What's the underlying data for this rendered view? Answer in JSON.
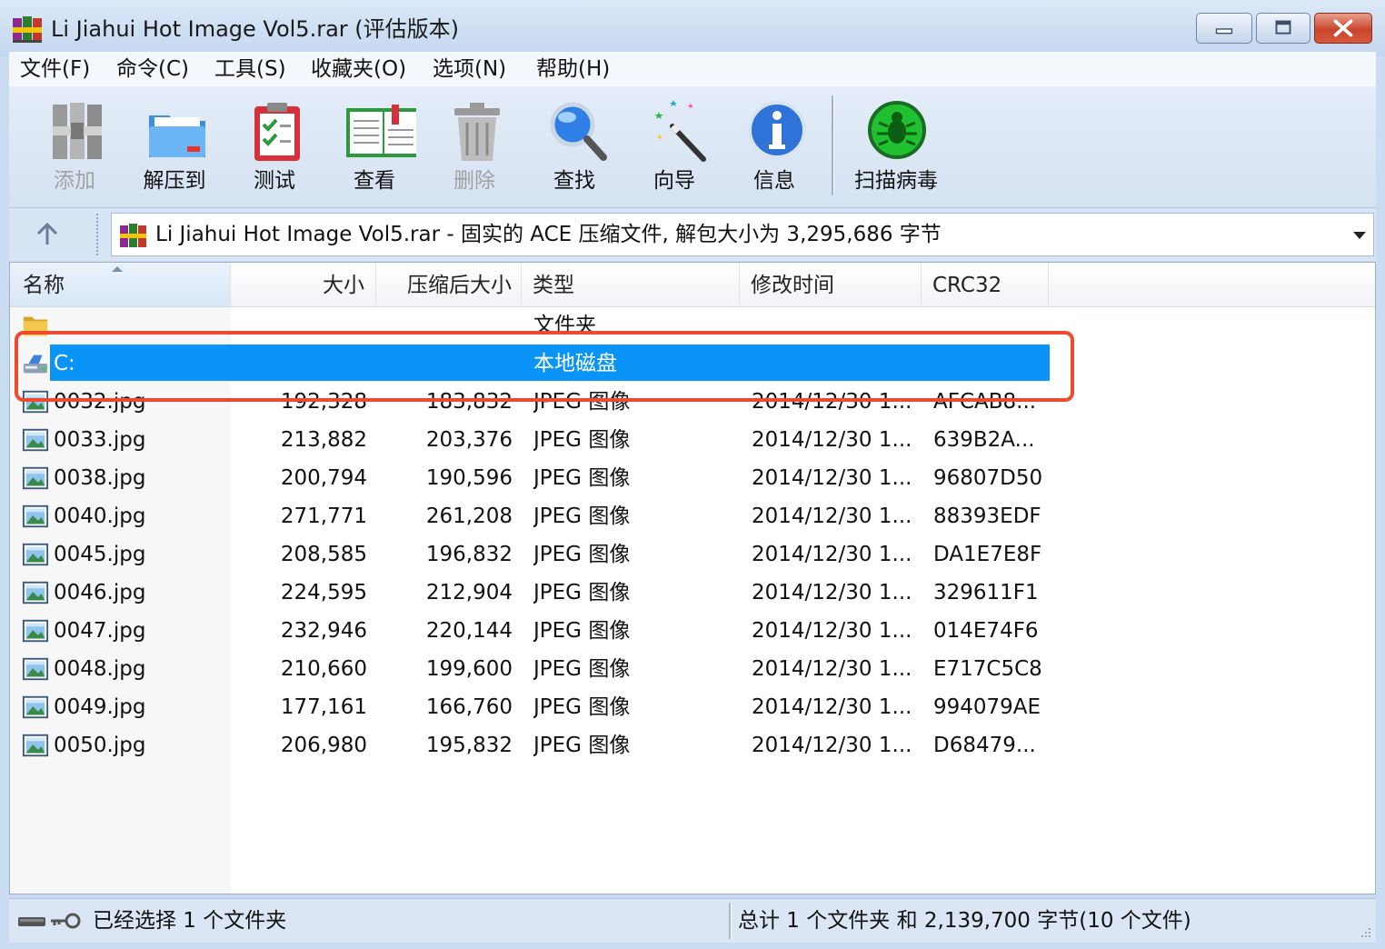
{
  "window": {
    "title": "Li Jiahui Hot Image Vol5.rar (评估版本)",
    "app_icon": "winrar-books-icon",
    "buttons": [
      "minimize",
      "maximize",
      "close"
    ]
  },
  "menu": [
    {
      "label": "文件(F)"
    },
    {
      "label": "命令(C)"
    },
    {
      "label": "工具(S)"
    },
    {
      "label": "收藏夹(O)"
    },
    {
      "label": "选项(N)"
    },
    {
      "label": "帮助(H)"
    }
  ],
  "toolbar": [
    {
      "label": "添加",
      "icon": "add-archive-icon",
      "enabled": false
    },
    {
      "label": "解压到",
      "icon": "extract-folder-icon",
      "enabled": true
    },
    {
      "label": "测试",
      "icon": "test-clipboard-icon",
      "enabled": true
    },
    {
      "label": "查看",
      "icon": "view-book-icon",
      "enabled": true
    },
    {
      "label": "删除",
      "icon": "delete-trash-icon",
      "enabled": false
    },
    {
      "label": "查找",
      "icon": "find-magnifier-icon",
      "enabled": true
    },
    {
      "label": "向导",
      "icon": "wizard-wand-icon",
      "enabled": true
    },
    {
      "label": "信息",
      "icon": "info-icon",
      "enabled": true
    },
    {
      "label": "扫描病毒",
      "icon": "virus-scan-icon",
      "enabled": true
    }
  ],
  "address": {
    "text": "Li Jiahui Hot Image Vol5.rar - 固实的 ACE 压缩文件, 解包大小为 3,295,686 字节"
  },
  "columns": {
    "name": "名称",
    "size": "大小",
    "packed": "压缩后大小",
    "type": "类型",
    "mtime": "修改时间",
    "crc": "CRC32"
  },
  "rows": [
    {
      "icon": "folder-icon",
      "name": "",
      "size": "",
      "packed": "",
      "type": "文件夹",
      "mtime": "",
      "crc": "",
      "selected": false
    },
    {
      "icon": "local-disk-icon",
      "name": "C:",
      "size": "",
      "packed": "",
      "type": "本地磁盘",
      "mtime": "",
      "crc": "",
      "selected": true
    },
    {
      "icon": "image-file-icon",
      "name": "0032.jpg",
      "size": "192,328",
      "packed": "183,832",
      "type": "JPEG 图像",
      "mtime": "2014/12/30 1...",
      "crc": "AFCAB8...",
      "selected": false
    },
    {
      "icon": "image-file-icon",
      "name": "0033.jpg",
      "size": "213,882",
      "packed": "203,376",
      "type": "JPEG 图像",
      "mtime": "2014/12/30 1...",
      "crc": "639B2A...",
      "selected": false
    },
    {
      "icon": "image-file-icon",
      "name": "0038.jpg",
      "size": "200,794",
      "packed": "190,596",
      "type": "JPEG 图像",
      "mtime": "2014/12/30 1...",
      "crc": "96807D50",
      "selected": false
    },
    {
      "icon": "image-file-icon",
      "name": "0040.jpg",
      "size": "271,771",
      "packed": "261,208",
      "type": "JPEG 图像",
      "mtime": "2014/12/30 1...",
      "crc": "88393EDF",
      "selected": false
    },
    {
      "icon": "image-file-icon",
      "name": "0045.jpg",
      "size": "208,585",
      "packed": "196,832",
      "type": "JPEG 图像",
      "mtime": "2014/12/30 1...",
      "crc": "DA1E7E8F",
      "selected": false
    },
    {
      "icon": "image-file-icon",
      "name": "0046.jpg",
      "size": "224,595",
      "packed": "212,904",
      "type": "JPEG 图像",
      "mtime": "2014/12/30 1...",
      "crc": "329611F1",
      "selected": false
    },
    {
      "icon": "image-file-icon",
      "name": "0047.jpg",
      "size": "232,946",
      "packed": "220,144",
      "type": "JPEG 图像",
      "mtime": "2014/12/30 1...",
      "crc": "014E74F6",
      "selected": false
    },
    {
      "icon": "image-file-icon",
      "name": "0048.jpg",
      "size": "210,660",
      "packed": "199,600",
      "type": "JPEG 图像",
      "mtime": "2014/12/30 1...",
      "crc": "E717C5C8",
      "selected": false
    },
    {
      "icon": "image-file-icon",
      "name": "0049.jpg",
      "size": "177,161",
      "packed": "166,760",
      "type": "JPEG 图像",
      "mtime": "2014/12/30 1...",
      "crc": "994079AE",
      "selected": false
    },
    {
      "icon": "image-file-icon",
      "name": "0050.jpg",
      "size": "206,980",
      "packed": "195,832",
      "type": "JPEG 图像",
      "mtime": "2014/12/30 1...",
      "crc": "D68479...",
      "selected": false
    }
  ],
  "status": {
    "left": "已经选择 1 个文件夹",
    "right": "总计 1 个文件夹 和 2,139,700 字节(10 个文件)"
  },
  "colors": {
    "selection": "#0a94f7",
    "highlight_outline": "#ef4a2e",
    "chrome": "#c9dcf2"
  }
}
